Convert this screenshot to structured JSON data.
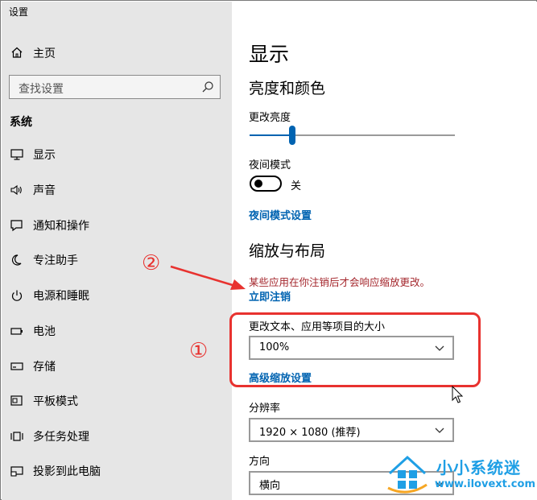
{
  "window": {
    "title": "设置"
  },
  "sidebar": {
    "home_label": "主页",
    "search_placeholder": "查找设置",
    "section_label": "系统",
    "items": [
      {
        "label": "显示",
        "icon": "monitor-icon"
      },
      {
        "label": "声音",
        "icon": "speaker-icon"
      },
      {
        "label": "通知和操作",
        "icon": "notification-icon"
      },
      {
        "label": "专注助手",
        "icon": "moon-icon"
      },
      {
        "label": "电源和睡眠",
        "icon": "power-icon"
      },
      {
        "label": "电池",
        "icon": "battery-icon"
      },
      {
        "label": "存储",
        "icon": "storage-icon"
      },
      {
        "label": "平板模式",
        "icon": "tablet-mode-icon"
      },
      {
        "label": "多任务处理",
        "icon": "multitasking-icon"
      },
      {
        "label": "投影到此电脑",
        "icon": "project-icon"
      }
    ]
  },
  "main": {
    "page_title": "显示",
    "brightness_section": "亮度和颜色",
    "brightness_label": "更改亮度",
    "brightness_level": 0.2,
    "night_light_label": "夜间模式",
    "night_light_state": "关",
    "night_light_link": "夜间模式设置",
    "scale_section": "缩放与布局",
    "scale_warning": "某些应用在你注销后才会响应缩放更改。",
    "sign_out_link": "立即注销",
    "scale_label": "更改文本、应用等项目的大小",
    "scale_value": "100%",
    "advanced_scale_link": "高级缩放设置",
    "resolution_label": "分辨率",
    "resolution_value": "1920 × 1080 (推荐)",
    "orientation_label": "方向",
    "orientation_value": "横向"
  },
  "annotations": {
    "marker_1": "①",
    "marker_2": "②",
    "accent_color": "#e8322f"
  },
  "watermark": {
    "site_name": "小小系统迷",
    "url": "www.ilovext.com"
  },
  "colors": {
    "sidebar_bg": "#e6e6e6",
    "link": "#0063b1",
    "warning": "#a4262c"
  }
}
